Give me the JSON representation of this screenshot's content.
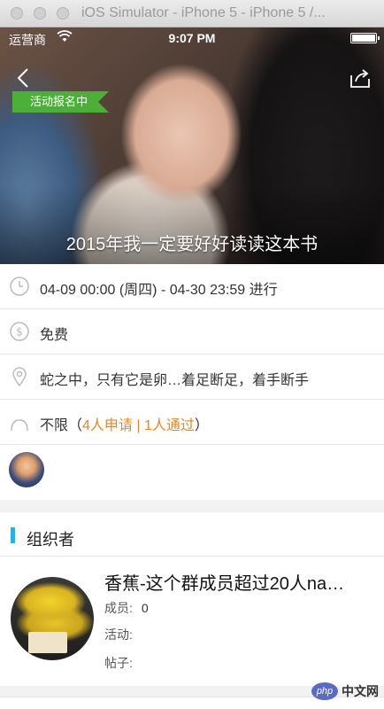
{
  "window": {
    "title": "iOS Simulator - iPhone 5 - iPhone 5 /..."
  },
  "status_bar": {
    "carrier": "运营商",
    "time": "9:07 PM"
  },
  "hero": {
    "badge": "活动报名中",
    "title": "2015年我一定要好好读读这本书"
  },
  "info": {
    "time": "04-09 00:00 (周四) - 04-30 23:59 进行",
    "price": "免费",
    "location": "蛇之中，只有它是卵…着足断足，着手断手",
    "limit_prefix": "不限（",
    "limit_applied": "4人申请 | 1人通过",
    "limit_suffix": "）"
  },
  "organizer": {
    "section_title": "组织者",
    "name": "香蕉-这个群成员超过20人na…",
    "members_label": "成员:",
    "members_value": "0",
    "activities_label": "活动:",
    "posts_label": "帖子:"
  },
  "watermark": {
    "logo": "php",
    "text": "中文网"
  },
  "colors": {
    "badge": "#4caf38",
    "accent_orange": "#e3862a",
    "section_bar": "#2bb0e0"
  }
}
